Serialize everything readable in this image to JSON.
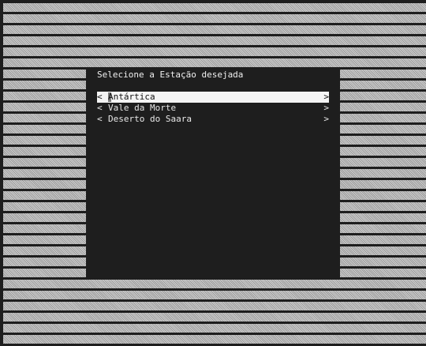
{
  "dialog": {
    "title": "Selecione a Estação desejada",
    "items": [
      {
        "left_arrow": "<",
        "label": "Antártica",
        "right_arrow": ">"
      },
      {
        "left_arrow": "<",
        "label": "Vale da Morte",
        "right_arrow": ">"
      },
      {
        "left_arrow": "<",
        "label": "Deserto do Saara",
        "right_arrow": ">"
      }
    ],
    "selected_index": 0
  },
  "colors": {
    "background": "#1e1e1e",
    "text": "#e8e8e8",
    "highlight": "#f4f4f4",
    "backdrop": "#b5b5b5"
  }
}
